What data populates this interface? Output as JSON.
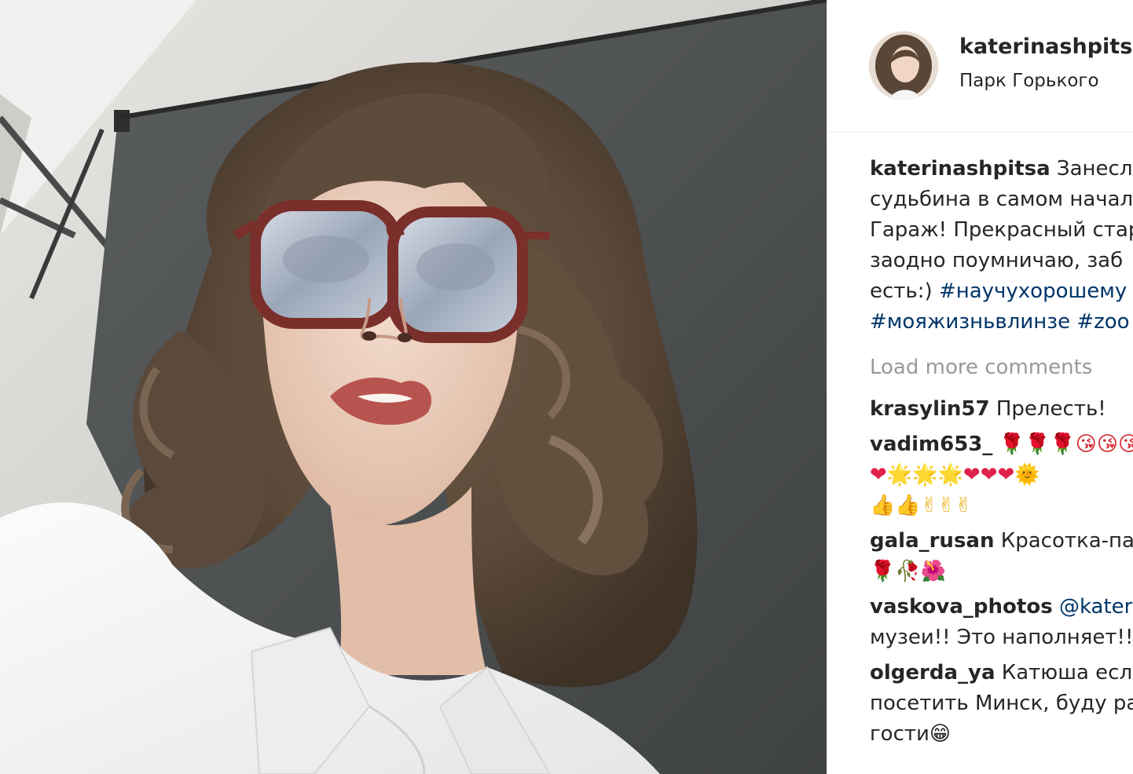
{
  "post": {
    "username": "katerinashpitsa",
    "location": "Парк Горького"
  },
  "caption": {
    "username": "katerinashpitsa",
    "lines": [
      "Занесла",
      "судьбина в самом начал",
      "Гараж! Прекрасный стар",
      "заодно поумничаю, заб",
      "есть:)"
    ],
    "hashtag_1": "#научухорошему",
    "hashtag_line": "#мояжизньвлинзе #zoo"
  },
  "load_more": "Load more comments",
  "comments": [
    {
      "username": "krasylin57",
      "lines": [
        "Прелесть!"
      ]
    },
    {
      "username": "vadim653_",
      "lines": [
        "🌹🌹🌹😘😘😘",
        "❤🌟🌟🌟❤❤❤🌞",
        "👍👍✌✌✌"
      ]
    },
    {
      "username": "gala_rusan",
      "lines": [
        "Красотка-пал",
        "🌹🥀🌺"
      ]
    },
    {
      "username": "vaskova_photos",
      "lines": [
        "@kateri",
        "музеи!! Это наполняет!!"
      ]
    },
    {
      "username": "olgerda_ya",
      "lines": [
        "Катюша если",
        "посетить Минск, буду ра",
        "гости😁"
      ]
    }
  ],
  "colors": {
    "hashtag": "#003569",
    "muted": "#999999",
    "text": "#262626"
  }
}
